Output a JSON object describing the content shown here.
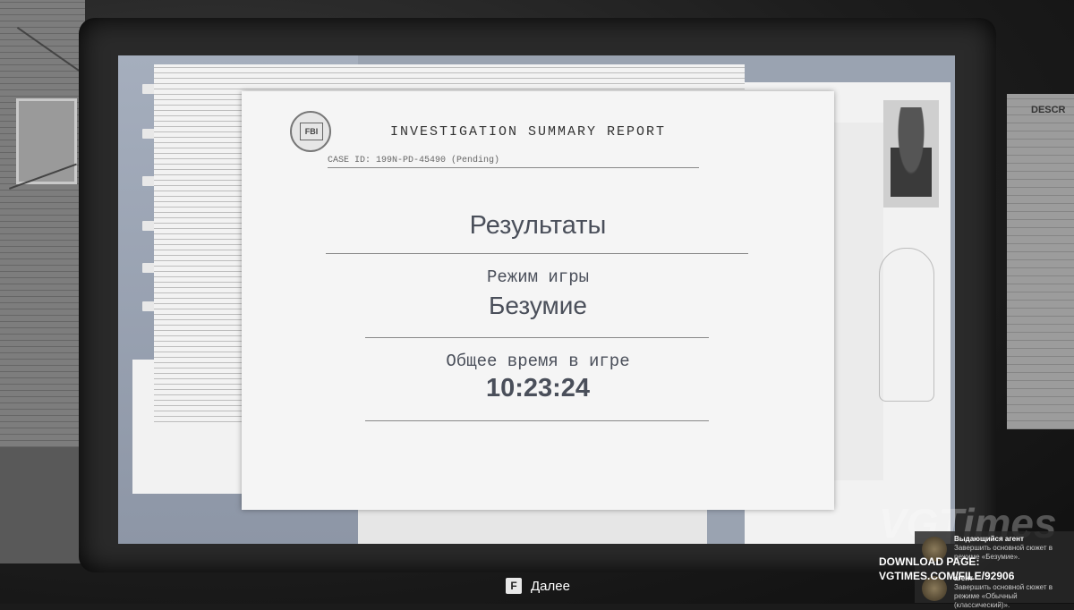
{
  "report": {
    "header_title": "INVESTIGATION SUMMARY REPORT",
    "seal_text": "FBI",
    "case_id": "CASE ID: 199N-PD-45490 (Pending)",
    "results_heading": "Результаты",
    "game_mode_label": "Режим игры",
    "game_mode_value": "Безумие",
    "total_time_label": "Общее время в игре",
    "total_time_value": "10:23:24"
  },
  "background": {
    "right_paper_title": "DESCR"
  },
  "prompt": {
    "key": "F",
    "label": "Далее"
  },
  "watermark": {
    "text": "VGTimes",
    "download_line1": "DOWNLOAD PAGE:",
    "download_line2": "VGTIMES.COM/FILE/92906"
  },
  "achievements": [
    {
      "title": "Выдающийся агент",
      "description": "Завершить основной сюжет в режиме «Безумие»."
    },
    {
      "title": "агент",
      "description": "Завершить основной сюжет в режиме «Обычный (классический)»."
    }
  ],
  "colors": {
    "report_text": "#4a4f5a",
    "screen_bg": "#9aa3b1"
  }
}
